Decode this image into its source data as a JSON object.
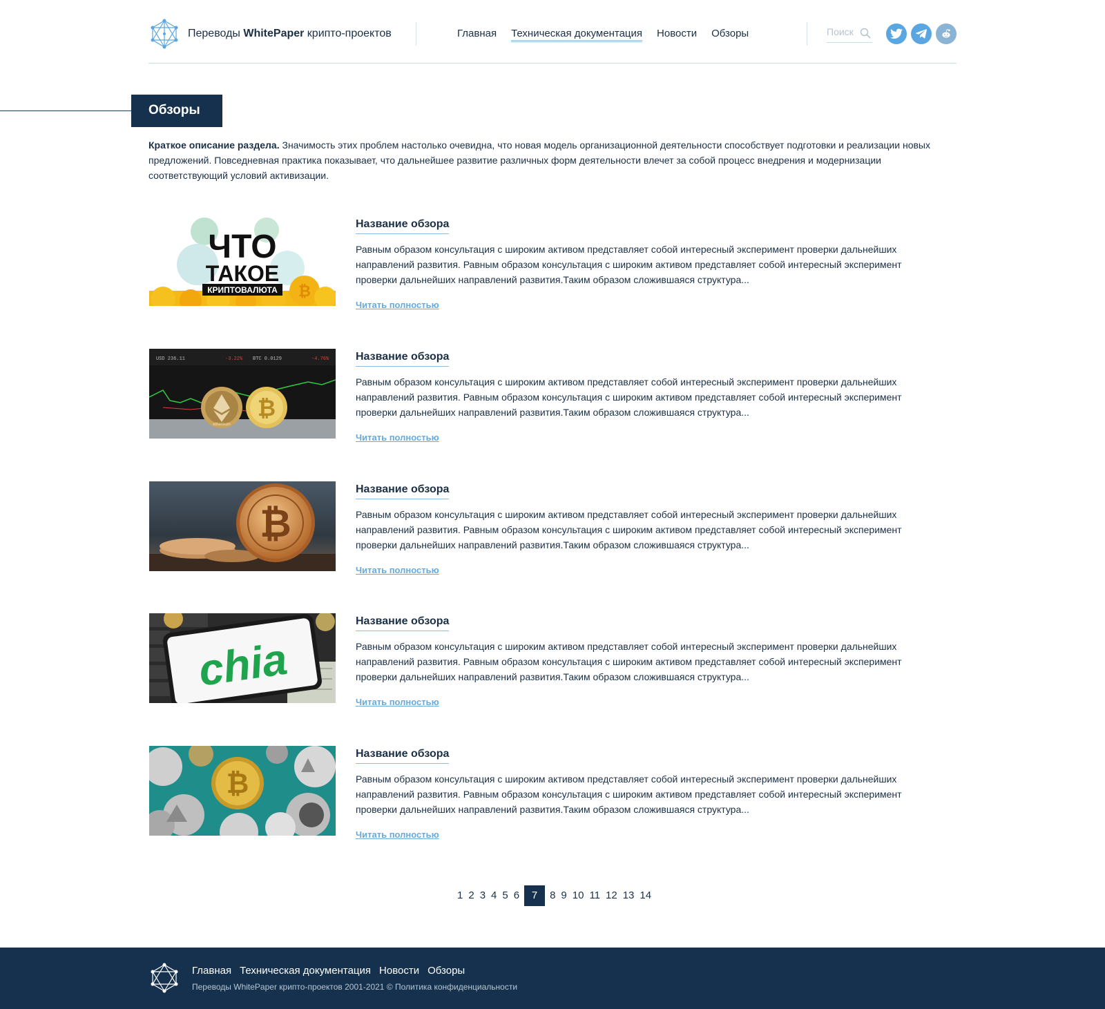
{
  "header": {
    "brand_prefix": "Переводы ",
    "brand_bold": "WhitePaper",
    "brand_suffix": " крипто-проектов",
    "nav": [
      "Главная",
      "Техническая документация",
      "Новости",
      "Обзоры"
    ],
    "active_nav": "Техническая документация",
    "search_placeholder": "Поиск",
    "social_icons": [
      "twitter-icon",
      "telegram-icon",
      "reddit-icon"
    ]
  },
  "section": {
    "title": "Обзоры",
    "intro_bold": "Краткое описание раздела.",
    "intro_text": " Значимость этих проблем настолько очевидна, что новая модель организационной деятельности способствует подготовки и реализации новых предложений. Повседневная практика показывает, что дальнейшее развитие различных форм деятельности влечет за собой процесс внедрения и модернизации соответствующий условий активизации."
  },
  "articles": [
    {
      "title": "Название обзора",
      "text": "Равным образом консультация с широким активом представляет собой интересный эксперимент проверки дальнейших направлений развития. Равным образом консультация с широким активом представляет собой интересный эксперимент проверки дальнейших направлений развития.Таким образом сложившаяся структура...",
      "link": "Читать полностью",
      "image": {
        "kind": "что-такое-криптовалюта",
        "line1": "ЧТО",
        "line2": "ТАКОЕ",
        "line3": "КРИПТОВАЛЮТА"
      }
    },
    {
      "title": "Название обзора",
      "text": "Равным образом консультация с широким активом представляет собой интересный эксперимент проверки дальнейших направлений развития. Равным образом консультация с широким активом представляет собой интересный эксперимент проверки дальнейших направлений развития.Таким образом сложившаяся структура...",
      "link": "Читать полностью",
      "image": {
        "kind": "ethereum-bitcoin-chart",
        "coin_label": "ethereum"
      }
    },
    {
      "title": "Название обзора",
      "text": "Равным образом консультация с широким активом представляет собой интересный эксперимент проверки дальнейших направлений развития. Равным образом консультация с широким активом представляет собой интересный эксперимент проверки дальнейших направлений развития.Таким образом сложившаяся структура...",
      "link": "Читать полностью",
      "image": {
        "kind": "bitcoin-coins"
      }
    },
    {
      "title": "Название обзора",
      "text": "Равным образом консультация с широким активом представляет собой интересный эксперимент проверки дальнейших направлений развития. Равным образом консультация с широким активом представляет собой интересный эксперимент проверки дальнейших направлений развития.Таким образом сложившаяся структура...",
      "link": "Читать полностью",
      "image": {
        "kind": "chia-phone",
        "logo_text": "chia"
      }
    },
    {
      "title": "Название обзора",
      "text": "Равным образом консультация с широким активом представляет собой интересный эксперимент проверки дальнейших направлений развития. Равным образом консультация с широким активом представляет собой интересный эксперимент проверки дальнейших направлений развития.Таким образом сложившаяся структура...",
      "link": "Читать полностью",
      "image": {
        "kind": "altcoins-pile"
      }
    }
  ],
  "pagination": {
    "pages": [
      "1",
      "2",
      "3",
      "4",
      "5",
      "6",
      "7",
      "8",
      "9",
      "10",
      "11",
      "12",
      "13",
      "14"
    ],
    "current": "7"
  },
  "footer": {
    "nav": [
      "Главная",
      "Техническая документация",
      "Новости",
      "Обзоры"
    ],
    "copyright": "Переводы WhitePaper крипто-проектов 2001-2021 © Политика конфиденциальности"
  },
  "colors": {
    "navy": "#15314d",
    "accent_blue": "#5aa6e0",
    "link_blue": "#6aa9d8",
    "text": "#1b2f45"
  }
}
